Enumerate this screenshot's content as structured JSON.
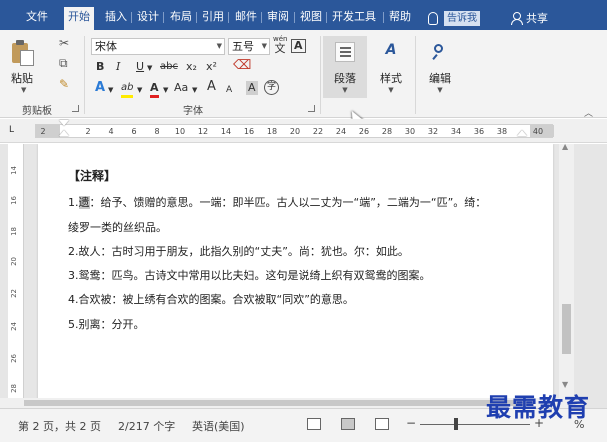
{
  "tabs": [
    {
      "label": "文件",
      "active": false
    },
    {
      "label": "开始",
      "active": true
    },
    {
      "label": "插入",
      "active": false
    },
    {
      "label": "设计",
      "active": false
    },
    {
      "label": "布局",
      "active": false
    },
    {
      "label": "引用",
      "active": false
    },
    {
      "label": "邮件",
      "active": false
    },
    {
      "label": "审阅",
      "active": false
    },
    {
      "label": "视图",
      "active": false
    },
    {
      "label": "开发工具",
      "active": false
    },
    {
      "label": "帮助",
      "active": false
    }
  ],
  "tell_me": "告诉我",
  "share": "共享",
  "ribbon": {
    "clipboard": {
      "paste": "粘贴",
      "label": "剪贴板"
    },
    "font": {
      "name": "宋体",
      "size": "五号",
      "wen": "wén",
      "wen_char": "文",
      "boxed_a": "A",
      "bold": "B",
      "italic": "I",
      "underline": "U",
      "strike": "abc",
      "subscript": "x₂",
      "superscript": "x²",
      "text_effects": "A",
      "highlight": "ab",
      "font_color": "A",
      "change_case": "Aa",
      "grow": "A",
      "shrink": "A",
      "char_shading": "A",
      "enclose": "字",
      "label": "字体"
    },
    "paragraph": {
      "label": "段落"
    },
    "styles": {
      "label": "样式"
    },
    "editing": {
      "label": "编辑"
    }
  },
  "ruler": {
    "left_label": "2",
    "ticks": [
      "2",
      "4",
      "6",
      "8",
      "10",
      "12",
      "14",
      "16",
      "18",
      "20",
      "22",
      "24",
      "26",
      "28",
      "30",
      "32",
      "34",
      "36",
      "38",
      "40"
    ],
    "vertical": [
      "14",
      "16",
      "18",
      "20",
      "22",
      "24",
      "26",
      "28"
    ]
  },
  "document": {
    "title": "【注释】",
    "lines": [
      {
        "prefix": "1.",
        "hl": "遗",
        "text": "：给予、馈赠的意思。一端：即半匹。古人以二丈为一“端”，二端为一“匹”。绮："
      },
      {
        "prefix": "",
        "hl": "",
        "text": "绫罗一类的丝织品。"
      },
      {
        "prefix": "2.",
        "hl": "",
        "text": "故人：古时习用于朋友，此指久别的“丈夫”。尚：犹也。尔：如此。"
      },
      {
        "prefix": "3.",
        "hl": "",
        "text": "鸳鸯：匹鸟。古诗文中常用以比夫妇。这句是说绮上织有双鸳鸯的图案。"
      },
      {
        "prefix": "4.",
        "hl": "",
        "text": "合欢被：被上绣有合欢的图案。合欢被取“同欢”的意思。"
      },
      {
        "prefix": "5.",
        "hl": "",
        "text": "别离：分开。"
      }
    ]
  },
  "status": {
    "page": "第 2 页，共 2 页",
    "words": "2/217 个字",
    "language": "英语(美国)",
    "zoom_percent": "%"
  },
  "watermark": "最需教育",
  "colors": {
    "accent": "#2b579a",
    "watermark": "#1f3fb0"
  }
}
